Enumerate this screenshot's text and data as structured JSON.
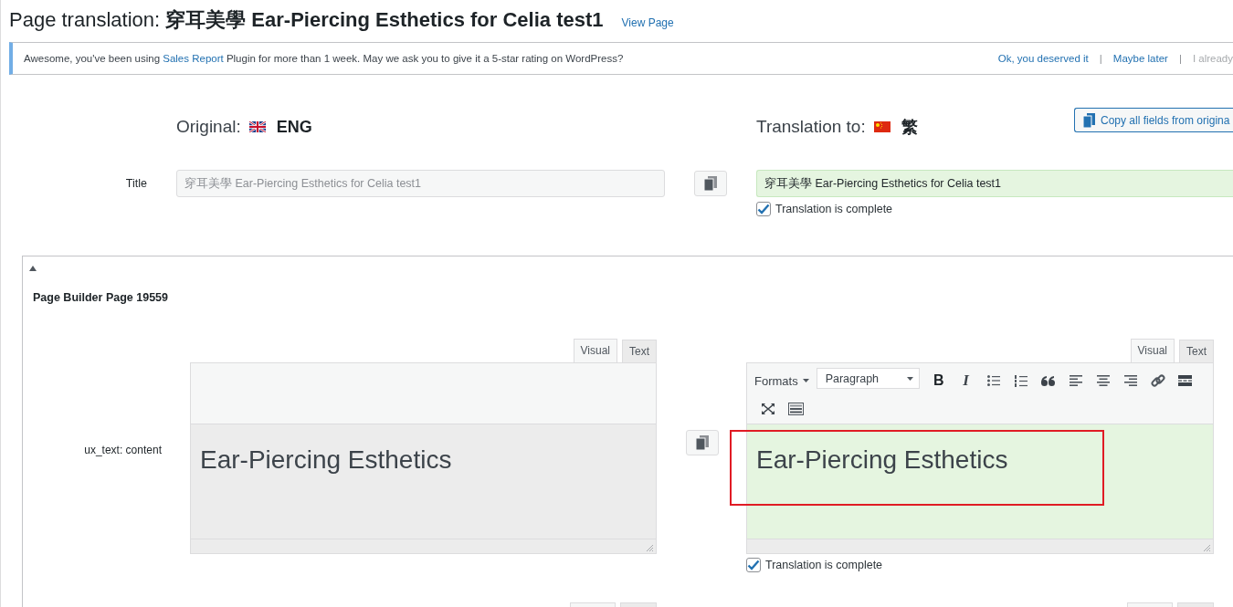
{
  "header": {
    "prefix": "Page translation: ",
    "name": "穿耳美學 Ear-Piercing Esthetics for Celia test1",
    "link": "View Page"
  },
  "notice": {
    "before": "Awesome, you've been using ",
    "link": "Sales Report",
    "after": " Plugin for more than 1 week. May we ask you to give it a 5-star rating on WordPress?",
    "actions": [
      {
        "kind": "link",
        "label": "Ok, you deserved it",
        "dimmed": false
      },
      {
        "kind": "separator",
        "label": "|"
      },
      {
        "kind": "link",
        "label": "Maybe later",
        "dimmed": false
      },
      {
        "kind": "separator",
        "label": "|"
      },
      {
        "kind": "link",
        "label": "I already",
        "dimmed": true
      }
    ]
  },
  "columns": {
    "original": {
      "label": "Original:",
      "language": "ENG"
    },
    "translation": {
      "label": "Translation to:",
      "language": "繁"
    },
    "copy_all_button": "Copy all fields from origina"
  },
  "title_field": {
    "label": "Title",
    "original": "穿耳美學 Ear-Piercing Esthetics for Celia test1",
    "translation": "穿耳美學 Ear-Piercing Esthetics for Celia test1",
    "complete": true,
    "complete_label": "Translation is complete"
  },
  "section": {
    "expanded": true,
    "title": "Page Builder Page 19559",
    "fields": [
      {
        "kind": "editor",
        "label": "ux_text: content",
        "original": {
          "tabs": [
            {
              "label": "Visual",
              "selected": true
            },
            {
              "label": "Text",
              "selected": false
            }
          ],
          "content": "Ear-Piercing Esthetics"
        },
        "translation": {
          "tabs": [
            {
              "label": "Visual",
              "selected": true
            },
            {
              "label": "Text",
              "selected": false
            }
          ],
          "content": "Ear-Piercing Esthetics",
          "highlighted": true,
          "toolbar": [
            {
              "kind": "formats",
              "label": "Formats"
            },
            {
              "kind": "select",
              "label": "Paragraph"
            },
            {
              "kind": "bold",
              "label": "B"
            },
            {
              "kind": "italic",
              "label": "I"
            },
            {
              "kind": "bullets"
            },
            {
              "kind": "numbers"
            },
            {
              "kind": "quote"
            },
            {
              "kind": "align-left"
            },
            {
              "kind": "align-center"
            },
            {
              "kind": "align-right"
            },
            {
              "kind": "link"
            },
            {
              "kind": "more"
            },
            {
              "kind": "fullscreen"
            },
            {
              "kind": "keyboard"
            }
          ]
        },
        "complete": true,
        "complete_label": "Translation is complete"
      },
      {
        "kind": "cut"
      }
    ]
  }
}
